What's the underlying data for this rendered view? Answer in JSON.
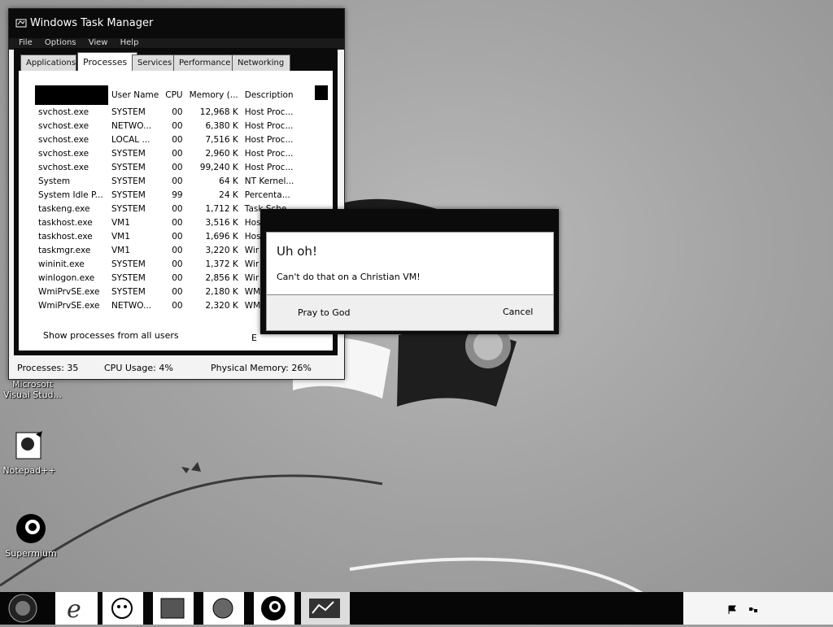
{
  "desktop": {
    "icons": [
      {
        "label": "Microsoft Visual Stud...",
        "icon": "visual-studio-icon"
      },
      {
        "label": "Notepad++",
        "icon": "notepad-plus-plus-icon"
      },
      {
        "label": "Supermium",
        "icon": "supermium-browser-icon"
      }
    ]
  },
  "task_manager": {
    "title": "Windows Task Manager",
    "menu": [
      "File",
      "Options",
      "View",
      "Help"
    ],
    "tabs": [
      {
        "label": "Applications",
        "active": false
      },
      {
        "label": "Processes",
        "active": true
      },
      {
        "label": "Services",
        "active": false
      },
      {
        "label": "Performance",
        "active": false
      },
      {
        "label": "Networking",
        "active": false
      }
    ],
    "columns": [
      "",
      "User Name",
      "CPU",
      "Memory (...",
      "Description"
    ],
    "rows": [
      {
        "name": "svchost.exe",
        "user": "SYSTEM",
        "cpu": "00",
        "memory": "12,968 K",
        "description": "Host Proc..."
      },
      {
        "name": "svchost.exe",
        "user": "NETWO...",
        "cpu": "00",
        "memory": "6,380 K",
        "description": "Host Proc..."
      },
      {
        "name": "svchost.exe",
        "user": "LOCAL ...",
        "cpu": "00",
        "memory": "7,516 K",
        "description": "Host Proc..."
      },
      {
        "name": "svchost.exe",
        "user": "SYSTEM",
        "cpu": "00",
        "memory": "2,960 K",
        "description": "Host Proc..."
      },
      {
        "name": "svchost.exe",
        "user": "SYSTEM",
        "cpu": "00",
        "memory": "99,240 K",
        "description": "Host Proc..."
      },
      {
        "name": "System",
        "user": "SYSTEM",
        "cpu": "00",
        "memory": "64 K",
        "description": "NT Kernel..."
      },
      {
        "name": "System Idle P...",
        "user": "SYSTEM",
        "cpu": "99",
        "memory": "24 K",
        "description": "Percenta..."
      },
      {
        "name": "taskeng.exe",
        "user": "SYSTEM",
        "cpu": "00",
        "memory": "1,712 K",
        "description": "Task Sche..."
      },
      {
        "name": "taskhost.exe",
        "user": "VM1",
        "cpu": "00",
        "memory": "3,516 K",
        "description": "Hos"
      },
      {
        "name": "taskhost.exe",
        "user": "VM1",
        "cpu": "00",
        "memory": "1,696 K",
        "description": "Hos"
      },
      {
        "name": "taskmgr.exe",
        "user": "VM1",
        "cpu": "00",
        "memory": "3,220 K",
        "description": "Wir"
      },
      {
        "name": "wininit.exe",
        "user": "SYSTEM",
        "cpu": "00",
        "memory": "1,372 K",
        "description": "Wir"
      },
      {
        "name": "winlogon.exe",
        "user": "SYSTEM",
        "cpu": "00",
        "memory": "2,856 K",
        "description": "Wir"
      },
      {
        "name": "WmiPrvSE.exe",
        "user": "SYSTEM",
        "cpu": "00",
        "memory": "2,180 K",
        "description": "WM"
      },
      {
        "name": "WmiPrvSE.exe",
        "user": "NETWO...",
        "cpu": "00",
        "memory": "2,320 K",
        "description": "WM"
      }
    ],
    "show_all_label": "Show processes from all users",
    "end_process_label": "E",
    "status": {
      "processes": "Processes: 35",
      "cpu_usage": "CPU Usage: 4%",
      "physical_memory": "Physical Memory: 26%"
    }
  },
  "dialog": {
    "heading": "Uh oh!",
    "message": "Can't do that on a Christian VM!",
    "primary_button": "Pray to God",
    "cancel_button": "Cancel"
  },
  "taskbar": {
    "items": [
      {
        "icon": "start-orb-icon"
      },
      {
        "icon": "internet-explorer-icon"
      },
      {
        "icon": "app-face-icon"
      },
      {
        "icon": "app-pattern-icon"
      },
      {
        "icon": "app-globe-icon"
      },
      {
        "icon": "supermium-browser-icon"
      },
      {
        "icon": "task-manager-active-icon"
      }
    ],
    "tray_icons": [
      "flag-icon",
      "network-icon"
    ]
  }
}
